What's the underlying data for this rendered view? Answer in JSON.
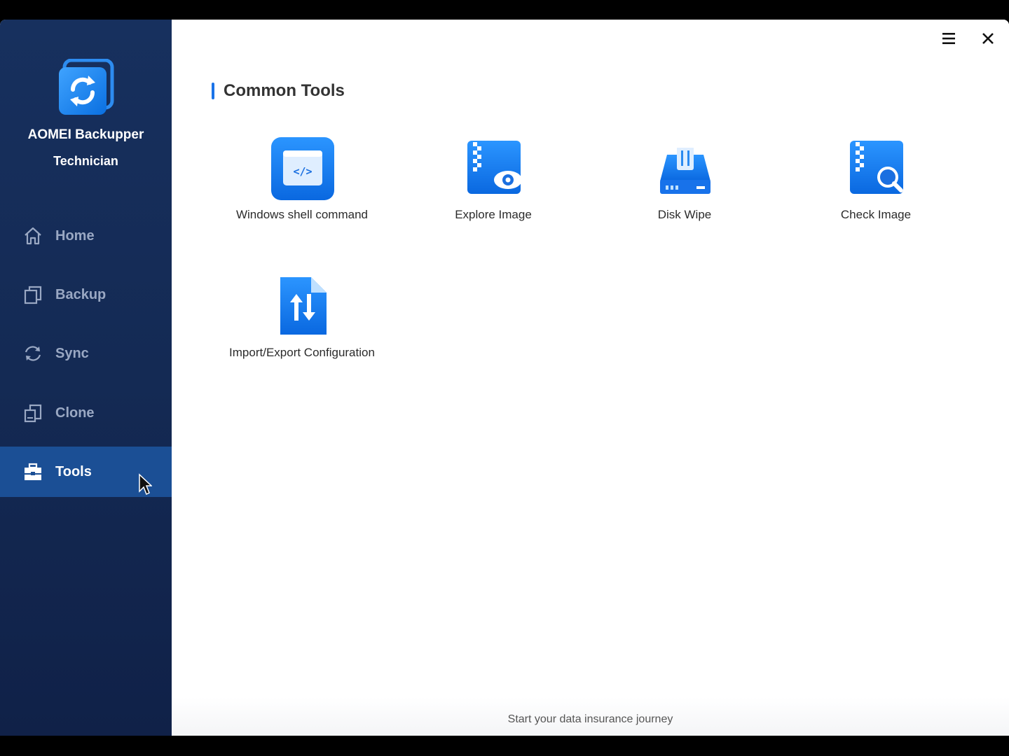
{
  "app": {
    "name": "AOMEI Backupper",
    "edition": "Technician"
  },
  "sidebar": {
    "items": [
      {
        "label": "Home",
        "icon": "home-icon",
        "active": false
      },
      {
        "label": "Backup",
        "icon": "backup-icon",
        "active": false
      },
      {
        "label": "Sync",
        "icon": "sync-icon",
        "active": false
      },
      {
        "label": "Clone",
        "icon": "clone-icon",
        "active": false
      },
      {
        "label": "Tools",
        "icon": "toolbox-icon",
        "active": true
      }
    ]
  },
  "window_controls": {
    "menu_icon": "hamburger-menu-icon",
    "close_icon": "close-icon"
  },
  "main": {
    "section_title": "Common Tools",
    "tools": [
      {
        "label": "Windows shell command",
        "icon": "shell-command-icon"
      },
      {
        "label": "Explore Image",
        "icon": "explore-image-icon"
      },
      {
        "label": "Disk Wipe",
        "icon": "disk-wipe-icon"
      },
      {
        "label": "Check Image",
        "icon": "check-image-icon"
      },
      {
        "label": "Import/Export Configuration",
        "icon": "import-export-icon"
      }
    ]
  },
  "footer": {
    "text": "Start your data insurance journey"
  },
  "colors": {
    "sidebar_bg": "#152c58",
    "active_item_bg": "#1b4f95",
    "accent": "#1a73e8"
  }
}
